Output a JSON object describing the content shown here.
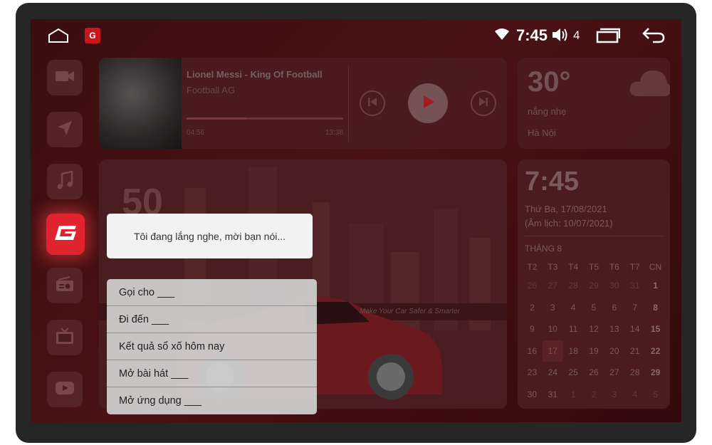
{
  "status": {
    "brand_letter": "G",
    "clock": "7:45",
    "volume": "4"
  },
  "music": {
    "title": "Lionel Messi - King Of Football",
    "artist": "Football AG",
    "elapsed": "04:56",
    "duration": "13:38",
    "progress": 0.38
  },
  "weather": {
    "temp": "30°",
    "desc": "nắng nhẹ",
    "city": "Hà Nội"
  },
  "car": {
    "speed": "50",
    "tagline": "Make Your Car Safer & Smarter"
  },
  "calendar": {
    "time": "7:45",
    "date": "Thứ Ba, 17/08/2021",
    "lunar": "(Âm lịch: 10/07/2021)",
    "month": "THÁNG 8",
    "weekdays": [
      "T2",
      "T3",
      "T4",
      "T5",
      "T6",
      "T7",
      "CN"
    ],
    "days": [
      [
        "26",
        "27",
        "28",
        "29",
        "30",
        "31",
        "1"
      ],
      [
        "2",
        "3",
        "4",
        "5",
        "6",
        "7",
        "8"
      ],
      [
        "9",
        "10",
        "11",
        "12",
        "13",
        "14",
        "15"
      ],
      [
        "16",
        "17",
        "18",
        "19",
        "20",
        "21",
        "22"
      ],
      [
        "23",
        "24",
        "25",
        "26",
        "27",
        "28",
        "29"
      ],
      [
        "30",
        "31",
        "1",
        "2",
        "3",
        "4",
        "5"
      ]
    ],
    "today": "17"
  },
  "voice": {
    "listening": "Tôi đang lắng nghe, mời bạn nói...",
    "suggestions": [
      "Gọi cho ___",
      "Đi đến ___",
      "Kết quả sổ xố hôm nay",
      "Mở bài hát ___",
      "Mở ứng dụng ___"
    ]
  }
}
